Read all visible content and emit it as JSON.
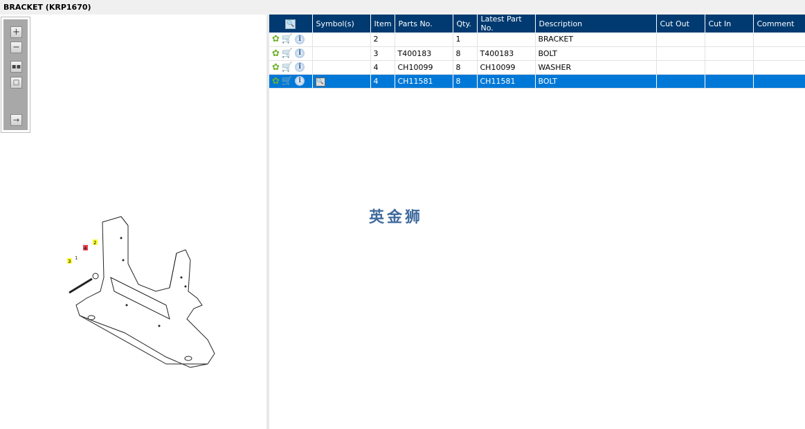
{
  "title": "BRACKET (KRP1670)",
  "toolbar": {
    "zoom_in": "zoom-in",
    "zoom_out": "zoom-out",
    "fit": "fit",
    "window": "window",
    "export": "export"
  },
  "diagram": {
    "callouts": [
      "1",
      "4",
      "2",
      "3"
    ],
    "highlight_color": "#e8485a",
    "callout_color": "#ffff33"
  },
  "table": {
    "headers": [
      "",
      "Symbol(s)",
      "Item",
      "Parts No.",
      "Qty.",
      "Latest Part No.",
      "Description",
      "Cut Out",
      "Cut In",
      "Comment"
    ],
    "rows": [
      {
        "item": "2",
        "part": "",
        "qty": "1",
        "latest": "",
        "desc": "BRACKET",
        "selected": false
      },
      {
        "item": "3",
        "part": "T400183",
        "qty": "8",
        "latest": "T400183",
        "desc": "BOLT",
        "selected": false
      },
      {
        "item": "4",
        "part": "CH10099",
        "qty": "8",
        "latest": "CH10099",
        "desc": "WASHER",
        "selected": false
      },
      {
        "item": "4",
        "part": "CH11581",
        "qty": "8",
        "latest": "CH11581",
        "desc": "BOLT",
        "selected": true
      }
    ]
  },
  "watermark": "英金狮",
  "colors": {
    "header": "#003a70",
    "selected": "#0078d7"
  }
}
